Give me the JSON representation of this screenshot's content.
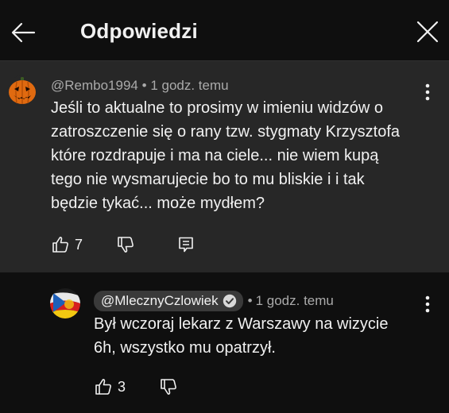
{
  "header": {
    "title": "Odpowiedzi",
    "back_icon": "arrow-left-icon",
    "close_icon": "close-icon"
  },
  "colors": {
    "background": "#0f0f0f",
    "highlighted_comment_bg": "#272727",
    "secondary_text": "#aaaaaa",
    "handle_chip_bg": "#3a3a3a"
  },
  "parent_comment": {
    "author": "@Rembo1994",
    "separator": "•",
    "time": "1 godz. temu",
    "text": "Jeśli to aktualne to prosimy w imieniu widzów o\nzatroszczenie się o rany tzw. stygmaty Krzysztofa\nktóre rozdrapuje i ma na ciele... nie wiem kupą\ntego nie wysmarujecie bo to mu bliskie i i tak\nbędzie tykać... może mydłem?",
    "likes": "7",
    "avatar_icon": "pumpkin-avatar",
    "icons": [
      "like-icon",
      "dislike-icon",
      "reply-icon",
      "more-vert-icon"
    ]
  },
  "reply_comment": {
    "author": "@MlecznyCzlowiek",
    "verified_icon": "verified-check-icon",
    "separator": "•",
    "time": "1 godz. temu",
    "text": "Był wczoraj lekarz z Warszawy na wizycie\n6h, wszystko mu opatrzył.",
    "likes": "3",
    "avatar_icon": "flag-avatar",
    "icons": [
      "like-icon",
      "dislike-icon",
      "more-vert-icon"
    ]
  }
}
